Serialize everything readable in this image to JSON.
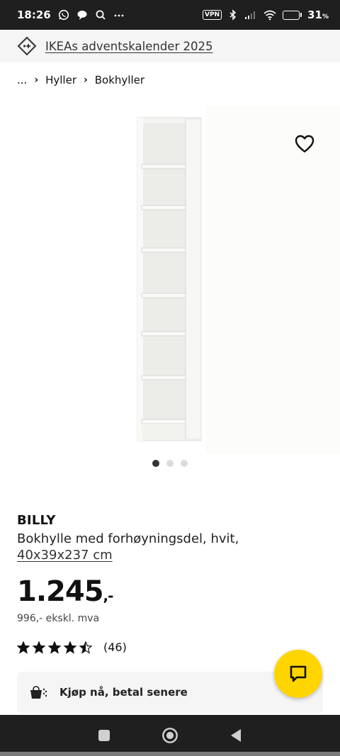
{
  "status_bar": {
    "time": "18:26",
    "vpn_label": "VPN",
    "battery_percent": "31",
    "battery_suffix": "%",
    "battery_level": 0.31
  },
  "banner": {
    "link_text": "IKEAs adventskalender 2025"
  },
  "breadcrumb": {
    "items": [
      "...",
      "Hyller",
      "Bokhyller"
    ]
  },
  "gallery": {
    "image_alt": "white tall narrow bookshelf",
    "page_count": 3,
    "active_index": 0
  },
  "product": {
    "brand": "BILLY",
    "description": "Bokhylle med forhøyningsdel, hvit,",
    "dimensions": "40x39x237 cm",
    "price_main": "1.245",
    "price_suffix": ",-",
    "price_ex_vat": "996,- ekskl. mva",
    "rating_value": 4.5,
    "rating_max": 5,
    "rating_count": "(46)"
  },
  "paylater": {
    "label": "Kjøp nå, betal senere"
  },
  "colors": {
    "accent_yellow": "#ffd500",
    "status_bar_bg": "#1f1f1f",
    "banner_bg": "#f5f5f5"
  }
}
